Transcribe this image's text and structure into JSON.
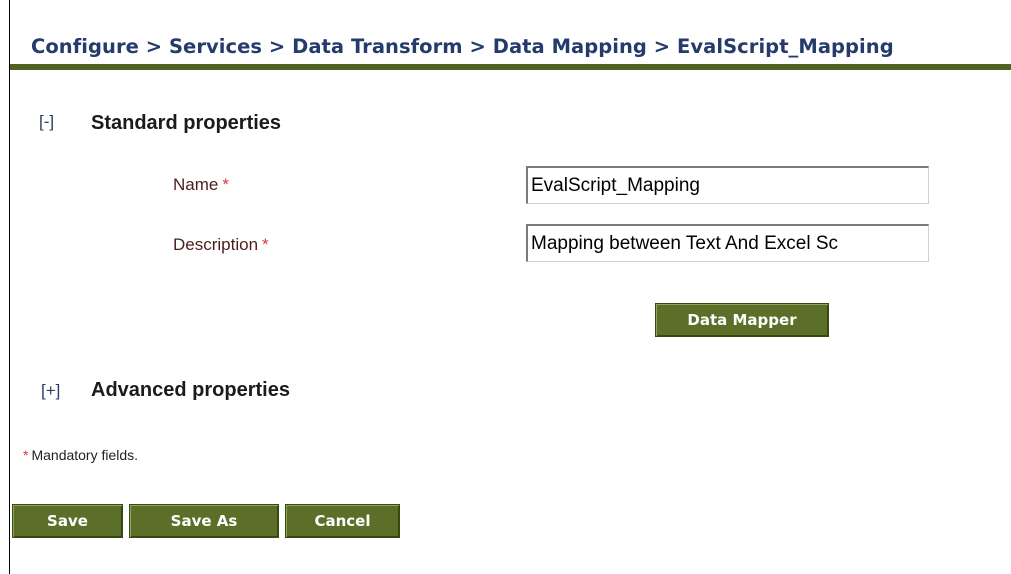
{
  "breadcrumb": "Configure > Services > Data Transform > Data Mapping > EvalScript_Mapping",
  "standard_section": {
    "toggle": "[-]",
    "title": "Standard properties"
  },
  "fields": {
    "name": {
      "label": "Name",
      "required_marker": "*",
      "value": "EvalScript_Mapping"
    },
    "description": {
      "label": "Description",
      "required_marker": "*",
      "value": "Mapping between Text And Excel Sc"
    }
  },
  "data_mapper_button": "Data Mapper",
  "advanced_section": {
    "toggle": "[+]",
    "title": "Advanced properties"
  },
  "mandatory_note": {
    "marker": "*",
    "text": "Mandatory fields."
  },
  "actions": {
    "save": "Save",
    "save_as": "Save As",
    "cancel": "Cancel"
  },
  "colors": {
    "breadcrumb_text": "#243b6b",
    "title_rule": "#4f621f",
    "button_bg": "#5b6f29",
    "required_marker": "#d23b3b",
    "label_text": "#4b1e1e"
  }
}
